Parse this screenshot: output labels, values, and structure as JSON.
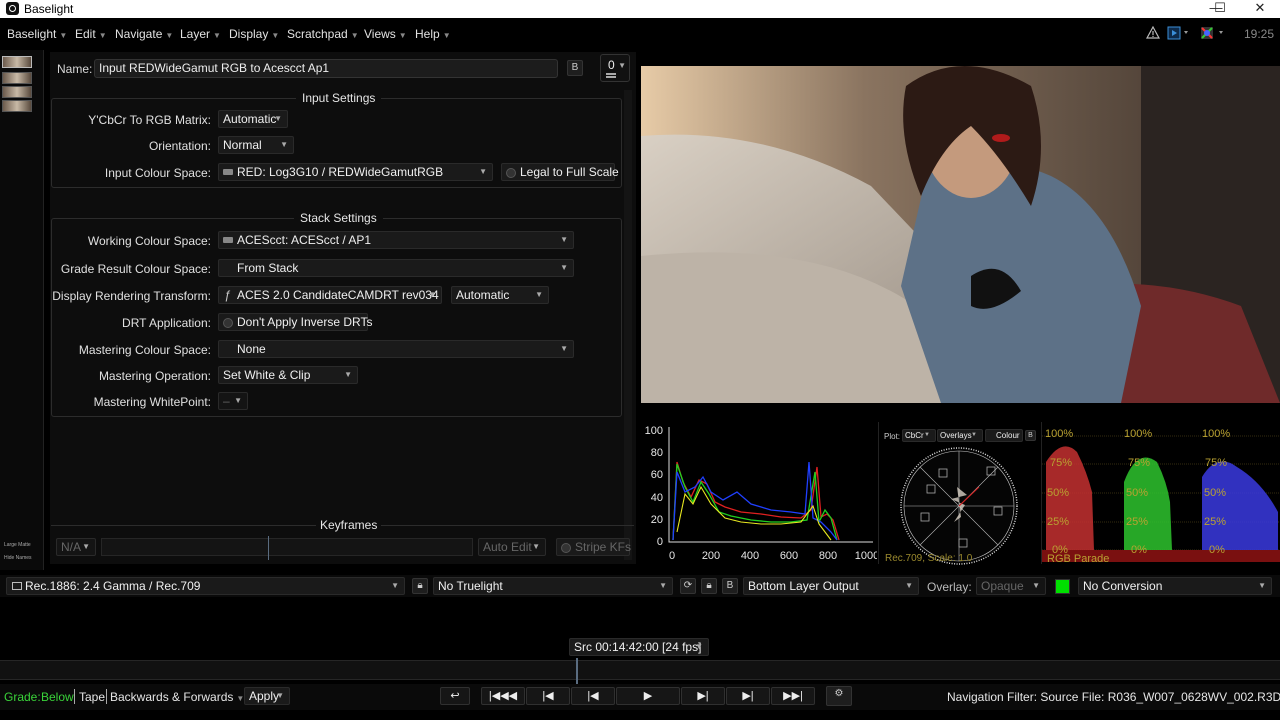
{
  "window": {
    "title": "Baselight",
    "minimize": "—",
    "maximize": "☐",
    "close": "✕"
  },
  "menu": [
    "Baselight",
    "Edit",
    "Navigate",
    "Layer",
    "Display",
    "Scratchpad",
    "Views",
    "Help"
  ],
  "clock": "19:25",
  "strip": {
    "large_matte": "Large Matte",
    "hide_names": "Hide Names"
  },
  "header": {
    "name_label": "Name:",
    "name_value": "Input REDWideGamut RGB to Acescct Ap1",
    "layer_count": "0"
  },
  "input_settings": {
    "title": "Input Settings",
    "ycbcr_label": "Y'CbCr To RGB Matrix:",
    "ycbcr_value": "Automatic",
    "orientation_label": "Orientation:",
    "orientation_value": "Normal",
    "colour_space_label": "Input Colour Space:",
    "colour_space_value": "RED: Log3G10 / REDWideGamutRGB",
    "legal_label": "Legal to Full Scale"
  },
  "stack_settings": {
    "title": "Stack Settings",
    "working_label": "Working Colour Space:",
    "working_value": "ACEScct: ACEScct / AP1",
    "grade_result_label": "Grade Result Colour Space:",
    "grade_result_value": "From Stack",
    "drt_label": "Display Rendering Transform:",
    "drt_value": "ACES 2.0 CandidateCAMDRT rev034",
    "drt_mode": "Automatic",
    "drt_app_label": "DRT Application:",
    "drt_app_value": "Don't Apply Inverse DRTs",
    "mastering_cs_label": "Mastering Colour Space:",
    "mastering_cs_value": "None",
    "mastering_op_label": "Mastering Operation:",
    "mastering_op_value": "Set White & Clip",
    "mastering_wp_label": "Mastering WhitePoint:",
    "mastering_wp_value": "–"
  },
  "keyframes": {
    "title": "Keyframes",
    "mode": "N/A",
    "auto_edit": "Auto Edit",
    "stripe": "Stripe KFs"
  },
  "histogram": {
    "y_ticks": [
      "100",
      "80",
      "60",
      "40",
      "20",
      "0"
    ],
    "x_ticks": [
      "0",
      "200",
      "400",
      "600",
      "800",
      "1000"
    ]
  },
  "vectorscope": {
    "plot_label": "Plot:",
    "plot_value": "CbCr",
    "overlays": "Overlays",
    "colour": "Colour",
    "caption": "Rec.709, Scale: 1.0"
  },
  "parade": {
    "pct100": "100%",
    "pct75": "75%",
    "pct50": "50%",
    "pct25": "25%",
    "pct0": "0%",
    "caption": "RGB Parade"
  },
  "display_bar": {
    "display_value": "Rec.1886: 2.4 Gamma / Rec.709",
    "truelight": "No Truelight",
    "output": "Bottom Layer Output",
    "overlay_label": "Overlay:",
    "overlay_value": "Opaque",
    "conversion": "No Conversion"
  },
  "timecode": "Src 00:14:42:00 [24 fps]",
  "status_bar": {
    "grade_label": "Grade:",
    "grade_value": "Below",
    "tape": "Tape",
    "direction": "Backwards & Forwards",
    "apply": "Apply",
    "nav_filter": "Navigation Filter: Source File: R036_W007_0628WV_002.R3D"
  },
  "transport": [
    "↩",
    "|◀◀◀",
    "|◀",
    "|◀",
    "▶",
    "▶|",
    "▶|",
    "▶▶|"
  ],
  "colors": {
    "accent_green": "#00e000",
    "grade_green": "#3ad43a"
  }
}
